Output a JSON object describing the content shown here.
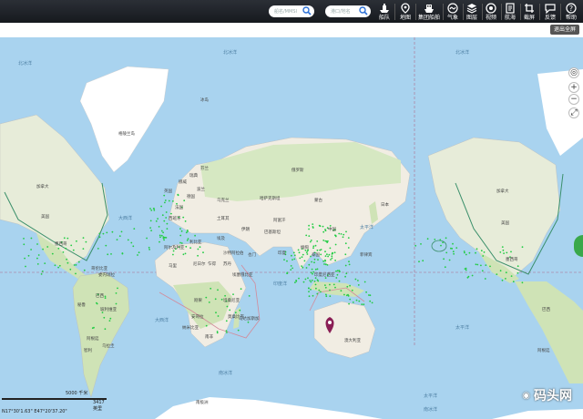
{
  "toolbar": {
    "search1_placeholder": "船名/MMSI",
    "search2_placeholder": "港口/地名",
    "tools": [
      {
        "label": "船队",
        "icon": "fleet-icon"
      },
      {
        "label": "地图",
        "icon": "map-icon"
      },
      {
        "label": "集团船舶",
        "icon": "group-ship-icon"
      },
      {
        "label": "气象",
        "icon": "weather-icon"
      },
      {
        "label": "图层",
        "icon": "layers-icon"
      },
      {
        "label": "视频",
        "icon": "video-icon"
      },
      {
        "label": "航海",
        "icon": "nautical-icon"
      },
      {
        "label": "截屏",
        "icon": "screenshot-icon"
      },
      {
        "label": "反馈",
        "icon": "feedback-icon"
      },
      {
        "label": "帮助",
        "icon": "help-icon"
      }
    ]
  },
  "subbar": {
    "exit_fullscreen": "退出全屏"
  },
  "map": {
    "ocean_labels": [
      "北冰洋",
      "北冰洋",
      "北冰洋",
      "太平洋",
      "大西洋",
      "太平洋",
      "大西洋",
      "印度洋",
      "太平洋",
      "南冰洋",
      "南冰洋"
    ],
    "country_labels": [
      "格陵兰岛",
      "冰岛",
      "俄罗斯",
      "加拿大",
      "美国",
      "墨西哥",
      "巴西",
      "秘鲁",
      "阿根廷",
      "中国",
      "印度",
      "澳大利亚",
      "南极洲",
      "加拿大",
      "美国",
      "墨西哥",
      "巴西",
      "阿根廷",
      "蒙古",
      "哈萨克斯坦",
      "伊朗",
      "沙特阿拉伯",
      "埃及",
      "利比亚",
      "阿尔及利亚",
      "马里",
      "尼日尔",
      "乍得",
      "苏丹",
      "刚果",
      "安哥拉",
      "南非",
      "芬兰",
      "瑞典",
      "挪威",
      "乌克兰",
      "土耳其",
      "巴基斯坦",
      "缅甸",
      "印度尼西亚",
      "纳米比亚",
      "坦桑尼亚",
      "莫桑比克",
      "马达加斯加",
      "埃塞俄比亚",
      "也门",
      "阿富汗",
      "日本",
      "菲律宾",
      "泰国",
      "哥伦比亚",
      "委内瑞拉",
      "玻利维亚",
      "智利",
      "乌拉圭",
      "法国",
      "西班牙",
      "德国",
      "英国",
      "波兰"
    ]
  },
  "scale": {
    "label": "5000 千米",
    "unit": "3417 英里"
  },
  "coords": "N17°30'1.63\" E47°20'37.20\"",
  "watermark": "码头网",
  "colors": {
    "ocean": "#a9d3ef",
    "land": "#f1ede3",
    "vegetation": "#cfe3b6",
    "ice": "#ffffff",
    "ship": "#22cc44",
    "accent": "#2b2f36"
  }
}
